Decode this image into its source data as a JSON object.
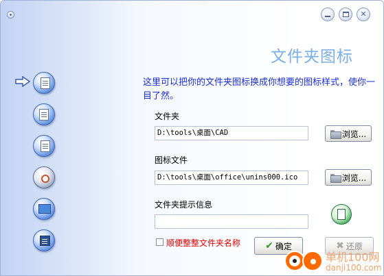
{
  "window": {
    "system_menu_icon": "system-menu-icon",
    "minimize_icon": "minimize-icon",
    "maximize_icon": "maximize-icon",
    "close_glyph": "✕"
  },
  "page": {
    "title": "文件夹图标",
    "description": "这里可以把你的文件夹图标换成你想要的图标样式，使你一目了然。"
  },
  "sidebar": {
    "selected_index": 0,
    "items": [
      {
        "icon": "folder-document-icon"
      },
      {
        "icon": "folder-cat-icon"
      },
      {
        "icon": "folder-lock-icon"
      },
      {
        "icon": "disc-icon"
      },
      {
        "icon": "monitor-icon"
      },
      {
        "icon": "window-icon"
      }
    ]
  },
  "form": {
    "folder_label": "文件夹",
    "folder_value": "D:\\tools\\桌面\\CAD",
    "browse_label": "浏览...",
    "icon_file_label": "图标文件",
    "icon_file_value": "D:\\tools\\桌面\\office\\unins000.ico",
    "browse2_label": "浏览...",
    "tip_label": "文件夹提示信息",
    "tip_value": "",
    "rename_checkbox_label": "顺便整整文件夹名称",
    "rename_checked": false,
    "ok_label": "确定",
    "restore_label": "还原"
  },
  "watermark": {
    "text": "单机100网",
    "url": "danji100.com"
  },
  "colors": {
    "title": "#7aaee6",
    "description": "#1a2fd1",
    "checkbox_label": "#e00000",
    "ok_check": "#2f9a2f"
  }
}
